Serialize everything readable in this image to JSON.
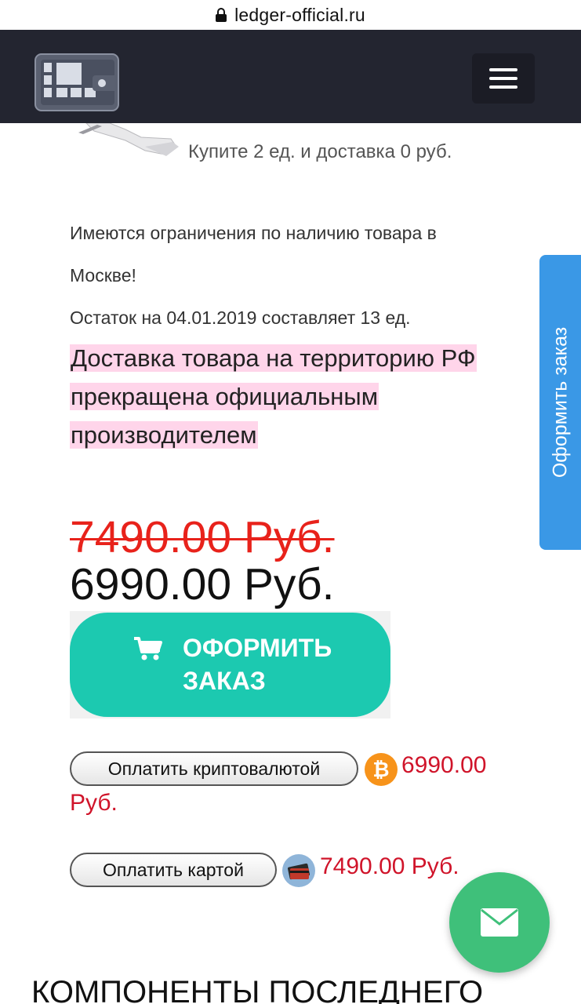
{
  "browser": {
    "url": "ledger-official.ru"
  },
  "header": {
    "logo_icon": "wallet-logo-icon",
    "menu_icon": "hamburger-menu-icon"
  },
  "promo": {
    "text": "Купите 2 ед. и доставка 0 руб."
  },
  "availability": {
    "line1": "Имеются ограничения по наличию товара в",
    "line2": "Москве!",
    "stock": "Остаток на 04.01.2019 составляет 13 ед."
  },
  "warning": {
    "text": "Доставка товара на территорию РФ прекращена официальным производителем"
  },
  "prices": {
    "old": "7490.00 Руб.",
    "new": "6990.00 Руб."
  },
  "order_button": {
    "label": "ОФОРМИТЬ ЗАКАЗ",
    "icon": "cart-icon"
  },
  "payment": {
    "crypto": {
      "label": "Оплатить криптовалютой",
      "price_part1": "6990.00",
      "price_part2": "Руб.",
      "icon": "bitcoin-icon"
    },
    "card": {
      "label": "Оплатить картой",
      "price": "7490.00 Руб.",
      "icon": "credit-card-icon"
    }
  },
  "side_tab": {
    "label": "Оформить заказ"
  },
  "mail_fab": {
    "icon": "envelope-icon"
  },
  "section": {
    "title": "КОМПОНЕНТЫ ПОСЛЕДНЕГО"
  },
  "colors": {
    "header_bg": "#232530",
    "teal": "#1cc9b0",
    "price_red": "#d0142a",
    "side_tab": "#3a98e6",
    "fab_green": "#3fc07a",
    "highlight": "#ffd5ea"
  }
}
